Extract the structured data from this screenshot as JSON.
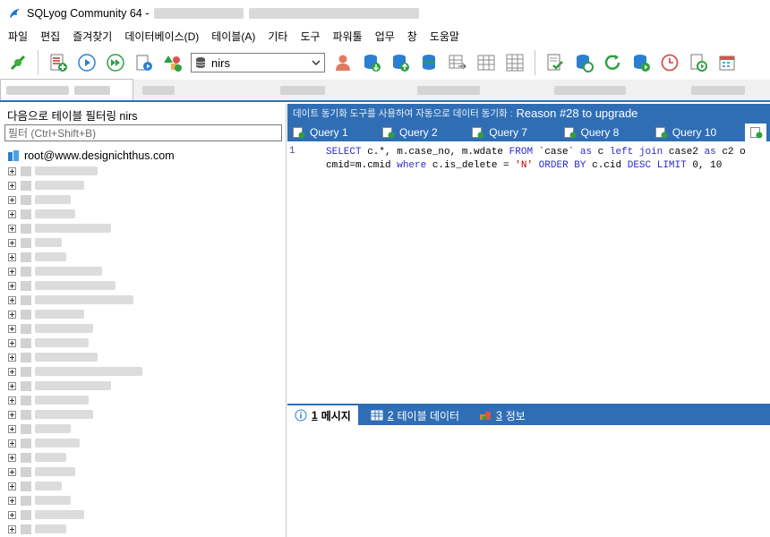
{
  "window": {
    "title": "SQLyog Community 64 -"
  },
  "menu": [
    "파일",
    "편집",
    "즐겨찾기",
    "데이터베이스(D)",
    "테이블(A)",
    "기타",
    "도구",
    "파워툴",
    "업무",
    "창",
    "도움말"
  ],
  "toolbar": {
    "database": "nirs"
  },
  "left": {
    "filter_label": "다음으로 테이블 필터링 nirs",
    "filter_placeholder": "필터 (Ctrl+Shift+B)",
    "root": "root@www.designichthus.com",
    "db_count": 26
  },
  "right": {
    "upgrade_ko": "데이트 동기화 도구를 사용하여 자동으로 데이터 동기화 :",
    "upgrade_reason": "Reason #28 to upgrade",
    "query_tabs": [
      "Query 1",
      "Query 2",
      "Query 7",
      "Query 8",
      "Query 10"
    ],
    "line_number": "1",
    "sql": {
      "l1_select": "SELECT",
      "l1_cols": " c.*, m.case_no, m.wdate ",
      "l1_from": "FROM",
      "l1_table": " `case` ",
      "l1_as": "as",
      "l1_c": " c ",
      "l1_left": "left join",
      "l1_case2": " case2 ",
      "l1_as2": "as",
      "l1_c2": " c2 o",
      "l2_pre": "cmid=m.cmid ",
      "l2_where": "where",
      "l2_cond": " c.is_delete = ",
      "l2_n": "'N'",
      "l2_order": " ORDER BY",
      "l2_cid": " c.cid ",
      "l2_desc": "DESC LIMIT",
      "l2_end": " 0, 10"
    },
    "result_tabs": [
      {
        "num": "1",
        "label": "메시지"
      },
      {
        "num": "2",
        "label": "테이블 데이터"
      },
      {
        "num": "3",
        "label": "정보"
      }
    ]
  },
  "colors": {
    "accent": "#2f6eb5"
  }
}
